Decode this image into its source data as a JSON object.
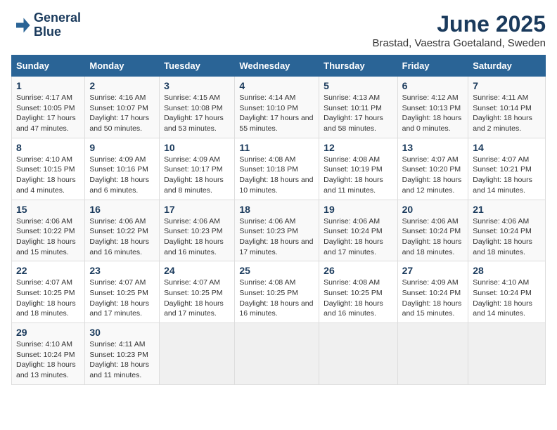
{
  "header": {
    "logo_line1": "General",
    "logo_line2": "Blue",
    "month": "June 2025",
    "location": "Brastad, Vaestra Goetaland, Sweden"
  },
  "weekdays": [
    "Sunday",
    "Monday",
    "Tuesday",
    "Wednesday",
    "Thursday",
    "Friday",
    "Saturday"
  ],
  "weeks": [
    [
      {
        "day": "1",
        "sunrise": "4:17 AM",
        "sunset": "10:05 PM",
        "daylight": "17 hours and 47 minutes."
      },
      {
        "day": "2",
        "sunrise": "4:16 AM",
        "sunset": "10:07 PM",
        "daylight": "17 hours and 50 minutes."
      },
      {
        "day": "3",
        "sunrise": "4:15 AM",
        "sunset": "10:08 PM",
        "daylight": "17 hours and 53 minutes."
      },
      {
        "day": "4",
        "sunrise": "4:14 AM",
        "sunset": "10:10 PM",
        "daylight": "17 hours and 55 minutes."
      },
      {
        "day": "5",
        "sunrise": "4:13 AM",
        "sunset": "10:11 PM",
        "daylight": "17 hours and 58 minutes."
      },
      {
        "day": "6",
        "sunrise": "4:12 AM",
        "sunset": "10:13 PM",
        "daylight": "18 hours and 0 minutes."
      },
      {
        "day": "7",
        "sunrise": "4:11 AM",
        "sunset": "10:14 PM",
        "daylight": "18 hours and 2 minutes."
      }
    ],
    [
      {
        "day": "8",
        "sunrise": "4:10 AM",
        "sunset": "10:15 PM",
        "daylight": "18 hours and 4 minutes."
      },
      {
        "day": "9",
        "sunrise": "4:09 AM",
        "sunset": "10:16 PM",
        "daylight": "18 hours and 6 minutes."
      },
      {
        "day": "10",
        "sunrise": "4:09 AM",
        "sunset": "10:17 PM",
        "daylight": "18 hours and 8 minutes."
      },
      {
        "day": "11",
        "sunrise": "4:08 AM",
        "sunset": "10:18 PM",
        "daylight": "18 hours and 10 minutes."
      },
      {
        "day": "12",
        "sunrise": "4:08 AM",
        "sunset": "10:19 PM",
        "daylight": "18 hours and 11 minutes."
      },
      {
        "day": "13",
        "sunrise": "4:07 AM",
        "sunset": "10:20 PM",
        "daylight": "18 hours and 12 minutes."
      },
      {
        "day": "14",
        "sunrise": "4:07 AM",
        "sunset": "10:21 PM",
        "daylight": "18 hours and 14 minutes."
      }
    ],
    [
      {
        "day": "15",
        "sunrise": "4:06 AM",
        "sunset": "10:22 PM",
        "daylight": "18 hours and 15 minutes."
      },
      {
        "day": "16",
        "sunrise": "4:06 AM",
        "sunset": "10:22 PM",
        "daylight": "18 hours and 16 minutes."
      },
      {
        "day": "17",
        "sunrise": "4:06 AM",
        "sunset": "10:23 PM",
        "daylight": "18 hours and 16 minutes."
      },
      {
        "day": "18",
        "sunrise": "4:06 AM",
        "sunset": "10:23 PM",
        "daylight": "18 hours and 17 minutes."
      },
      {
        "day": "19",
        "sunrise": "4:06 AM",
        "sunset": "10:24 PM",
        "daylight": "18 hours and 17 minutes."
      },
      {
        "day": "20",
        "sunrise": "4:06 AM",
        "sunset": "10:24 PM",
        "daylight": "18 hours and 18 minutes."
      },
      {
        "day": "21",
        "sunrise": "4:06 AM",
        "sunset": "10:24 PM",
        "daylight": "18 hours and 18 minutes."
      }
    ],
    [
      {
        "day": "22",
        "sunrise": "4:07 AM",
        "sunset": "10:25 PM",
        "daylight": "18 hours and 18 minutes."
      },
      {
        "day": "23",
        "sunrise": "4:07 AM",
        "sunset": "10:25 PM",
        "daylight": "18 hours and 17 minutes."
      },
      {
        "day": "24",
        "sunrise": "4:07 AM",
        "sunset": "10:25 PM",
        "daylight": "18 hours and 17 minutes."
      },
      {
        "day": "25",
        "sunrise": "4:08 AM",
        "sunset": "10:25 PM",
        "daylight": "18 hours and 16 minutes."
      },
      {
        "day": "26",
        "sunrise": "4:08 AM",
        "sunset": "10:25 PM",
        "daylight": "18 hours and 16 minutes."
      },
      {
        "day": "27",
        "sunrise": "4:09 AM",
        "sunset": "10:24 PM",
        "daylight": "18 hours and 15 minutes."
      },
      {
        "day": "28",
        "sunrise": "4:10 AM",
        "sunset": "10:24 PM",
        "daylight": "18 hours and 14 minutes."
      }
    ],
    [
      {
        "day": "29",
        "sunrise": "4:10 AM",
        "sunset": "10:24 PM",
        "daylight": "18 hours and 13 minutes."
      },
      {
        "day": "30",
        "sunrise": "4:11 AM",
        "sunset": "10:23 PM",
        "daylight": "18 hours and 11 minutes."
      },
      null,
      null,
      null,
      null,
      null
    ]
  ],
  "labels": {
    "sunrise": "Sunrise:",
    "sunset": "Sunset:",
    "daylight": "Daylight:"
  }
}
